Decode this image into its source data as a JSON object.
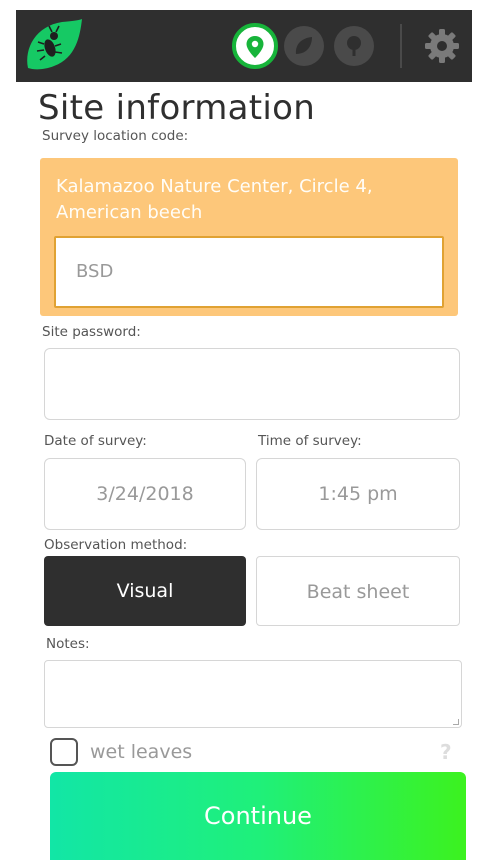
{
  "header": {
    "colors": {
      "bar": "#2f2f2f",
      "accent": "#17b43a",
      "inactive": "#4a4a4a"
    },
    "icons": [
      "leaf-logo-icon",
      "location-pin-icon",
      "leaf-icon",
      "tree-icon",
      "gear-icon"
    ],
    "active_step": "location"
  },
  "page": {
    "title": "Site information"
  },
  "survey_location": {
    "label": "Survey location code:",
    "site_name": "Kalamazoo Nature Center, Circle 4, American beech",
    "code_value": "BSD",
    "box_color": "#fdc77a"
  },
  "password": {
    "label": "Site password:",
    "value": ""
  },
  "date": {
    "label": "Date of survey:",
    "value": "3/24/2018"
  },
  "time": {
    "label": "Time of survey:",
    "value": "1:45 pm"
  },
  "observation": {
    "label": "Observation method:",
    "options": [
      "Visual",
      "Beat sheet"
    ],
    "selected": "Visual"
  },
  "notes": {
    "label": "Notes:",
    "value": ""
  },
  "wet_leaves": {
    "label": "wet leaves",
    "checked": false,
    "help": "?"
  },
  "continue_button": {
    "label": "Continue"
  }
}
